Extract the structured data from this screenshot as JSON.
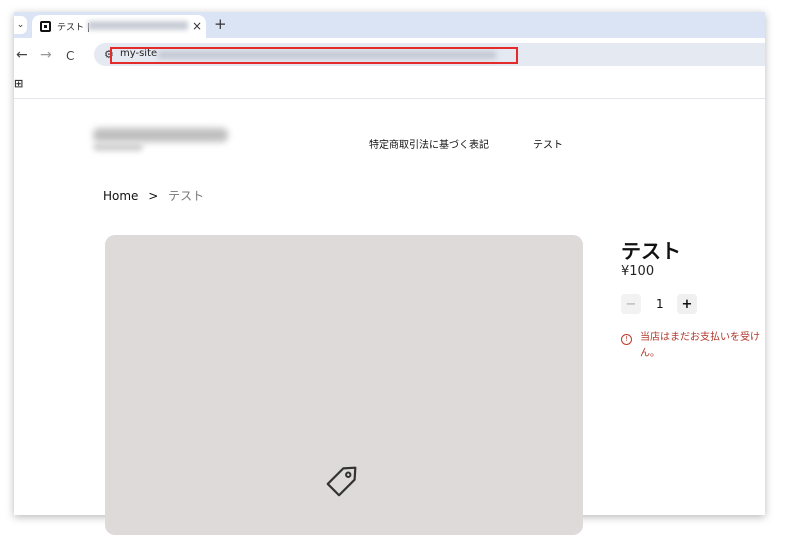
{
  "browser": {
    "tab": {
      "title": "テスト | ",
      "close_glyph": "×"
    },
    "tab_dropdown_glyph": "⌄",
    "new_tab_glyph": "+",
    "nav": {
      "back": "←",
      "forward": "→",
      "reload": "C"
    },
    "address": {
      "url": "my-site"
    },
    "bookmarks": {
      "apps_glyph": "⊞"
    }
  },
  "site": {
    "nav": [
      "特定商取引法に基づく表記",
      "テスト"
    ],
    "breadcrumb": {
      "home": "Home",
      "separator": ">",
      "current": "テスト"
    }
  },
  "product": {
    "title": "テスト",
    "price": "¥100",
    "quantity": {
      "minus": "−",
      "value": "1",
      "plus": "+"
    },
    "alert": {
      "icon": "!",
      "message": "当店はまだお支払いを受けん。"
    }
  },
  "colors": {
    "highlight": "#e32b2b",
    "tab_strip": "#dbe4f4",
    "image_placeholder": "#dedad9",
    "alert": "#b03a2e"
  },
  "icons": [
    "back-arrow-icon",
    "forward-arrow-icon",
    "reload-icon",
    "site-info-icon",
    "apps-icon",
    "tag-icon",
    "alert-icon"
  ]
}
